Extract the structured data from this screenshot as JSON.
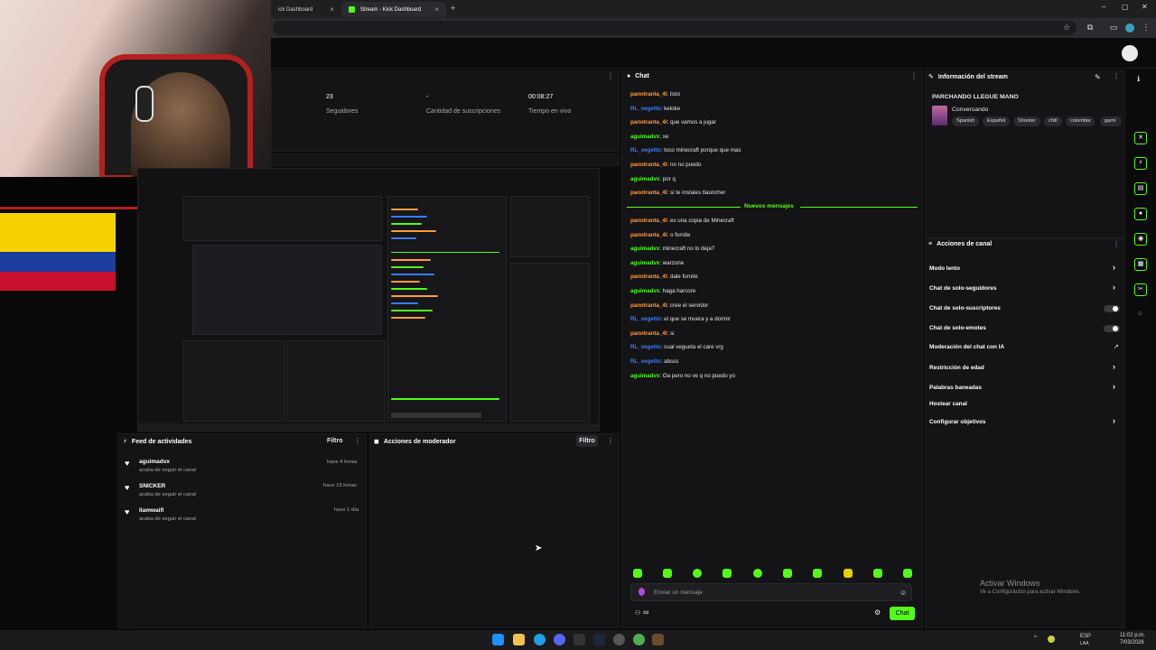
{
  "browser": {
    "tabs": [
      {
        "label": "ick Dashboard",
        "active": false
      },
      {
        "label": "Stream - Kick Dashboard",
        "active": true
      }
    ]
  },
  "stats": [
    {
      "value": "23",
      "label": "Seguidores"
    },
    {
      "value": "-",
      "label": "Cantidad de suscripciones"
    },
    {
      "value": "00:08:27",
      "label": "Tiempo en vivo"
    }
  ],
  "chat": {
    "title": "Chat",
    "messages_before": [
      {
        "user": "panotranta_4l",
        "text": "listo",
        "color": "orange"
      },
      {
        "user": "RL_vegetto",
        "text": "keloke",
        "color": "blue"
      },
      {
        "user": "panotranta_4l",
        "text": "que vamos a jugar",
        "color": "orange"
      },
      {
        "user": "aguimadvx",
        "text": "xe",
        "color": "green"
      },
      {
        "user": "RL_vegetto",
        "text": "toco minecraft porque que mas",
        "color": "blue"
      },
      {
        "user": "panotranta_4l",
        "text": "no no puedo",
        "color": "orange"
      },
      {
        "user": "aguimadvx",
        "text": "por q",
        "color": "green"
      },
      {
        "user": "panotranta_4l",
        "text": "si te instales tlauncher",
        "color": "orange"
      }
    ],
    "new_messages_label": "Nuevos mensajes",
    "messages_after": [
      {
        "user": "panotranta_4l",
        "text": "es una copia de Minecraft",
        "color": "orange"
      },
      {
        "user": "panotranta_4l",
        "text": "o fornite",
        "color": "orange"
      },
      {
        "user": "aguimadvx",
        "text": "minecraft no lo deja?",
        "color": "green"
      },
      {
        "user": "aguimadvx",
        "text": "warzone",
        "color": "green"
      },
      {
        "user": "panotranta_4l",
        "text": "dale fornite",
        "color": "orange"
      },
      {
        "user": "aguimadvx",
        "text": "haga harcore",
        "color": "green"
      },
      {
        "user": "panotranta_4l",
        "text": "cree el servidor",
        "color": "orange"
      },
      {
        "user": "RL_vegetto",
        "text": "el que se muera y a dormir",
        "color": "blue"
      },
      {
        "user": "panotranta_4l",
        "text": "si",
        "color": "orange"
      },
      {
        "user": "RL_vegetto",
        "text": "cual vegueta el care vrg",
        "color": "blue"
      },
      {
        "user": "RL_vegetto",
        "text": "absss",
        "color": "blue"
      },
      {
        "user": "aguimadvx",
        "text": "Oa pero no ve q no puedo yo",
        "color": "green"
      }
    ],
    "input_placeholder": "Enviar un mensaje",
    "send_label": "Chat",
    "infinity": "∞"
  },
  "stream_info": {
    "title": "Información del stream",
    "stream_title": "PARCHANDO LLEGUE MANO",
    "category": "Conversando",
    "tags": [
      "Spanish",
      "Español",
      "Shooter",
      "chill",
      "colombia",
      "gami"
    ]
  },
  "channel_actions": {
    "title": "Acciones de canal",
    "items": [
      {
        "label": "Modo lento",
        "control": "chevron"
      },
      {
        "label": "Chat de solo-seguidores",
        "control": "chevron"
      },
      {
        "label": "Chat de solo-suscriptores",
        "control": "toggle"
      },
      {
        "label": "Chat de solo-emotes",
        "control": "toggle"
      },
      {
        "label": "Moderación del chat con IA",
        "control": "external"
      },
      {
        "label": "Restricción de edad",
        "control": "chevron"
      },
      {
        "label": "Palabras baneadas",
        "control": "chevron"
      },
      {
        "label": "Hostear canal",
        "control": "none"
      },
      {
        "label": "Configurar objetivos",
        "control": "chevron"
      }
    ]
  },
  "activity_feed": {
    "title": "Feed de actividades",
    "filter_label": "Filtro",
    "items": [
      {
        "name": "aguimadvx",
        "sub": "acaba de seguir el canal",
        "time": "hace 4 horas"
      },
      {
        "name": "SNICKER",
        "sub": "acaba de seguir el canal",
        "time": "hace 15 horas"
      },
      {
        "name": "llamwaifi",
        "sub": "acaba de seguir el canal",
        "time": "hace 1 día"
      }
    ]
  },
  "moderator_actions": {
    "title": "Acciones de moderador",
    "filter_label": "Filtro"
  },
  "watermark": {
    "line1": "Activar Windows",
    "line2": "Ve a Configuración para activar Windows."
  },
  "taskbar": {
    "lang": "ESP",
    "lang2": "LAA",
    "time": "11:02 p.m.",
    "date": "7/03/2026"
  },
  "colors": {
    "accent": "#53fc18",
    "orange_user": "#ff9c40",
    "blue_user": "#3a7bff",
    "panel": "#141416"
  }
}
